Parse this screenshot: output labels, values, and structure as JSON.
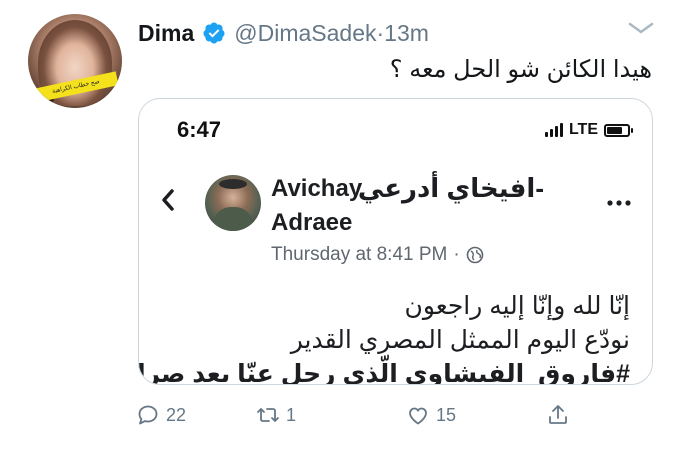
{
  "tweet": {
    "display_name": "Dima",
    "handle": "@DimaSadek",
    "separator": " · ",
    "time": "13m",
    "text": "هيدا الكائن شو الحل معه ؟",
    "verified": true,
    "avatar_ribbon_text": "صح خطاب الكراهية"
  },
  "embed": {
    "status_time": "6:47",
    "network": "LTE",
    "page_name_ar": "افيخاي أدرعي-",
    "page_name_en_line1": "Avichay",
    "page_name_en_line2": "Adraee",
    "post_time": "Thursday at 8:41 PM",
    "meta_separator": " · ",
    "body_lines": [
      "إنّا لله وإنّا إليه راجعون",
      "نودّع اليوم الممثل المصري القدير",
      "#فاروق_الفيشاوي الّذي رحل عنّا بعد صراع مع"
    ]
  },
  "actions": {
    "reply_count": "22",
    "retweet_count": "1",
    "like_count": "15"
  },
  "colors": {
    "text_primary": "#14171a",
    "text_secondary": "#657786",
    "verified_blue": "#1da1f2",
    "border": "#ccd6dd"
  },
  "icons": [
    "verified-icon",
    "more-icon",
    "signal-icon",
    "battery-icon",
    "back-chevron-icon",
    "globe-icon",
    "reply-icon",
    "retweet-icon",
    "like-icon",
    "share-icon"
  ]
}
